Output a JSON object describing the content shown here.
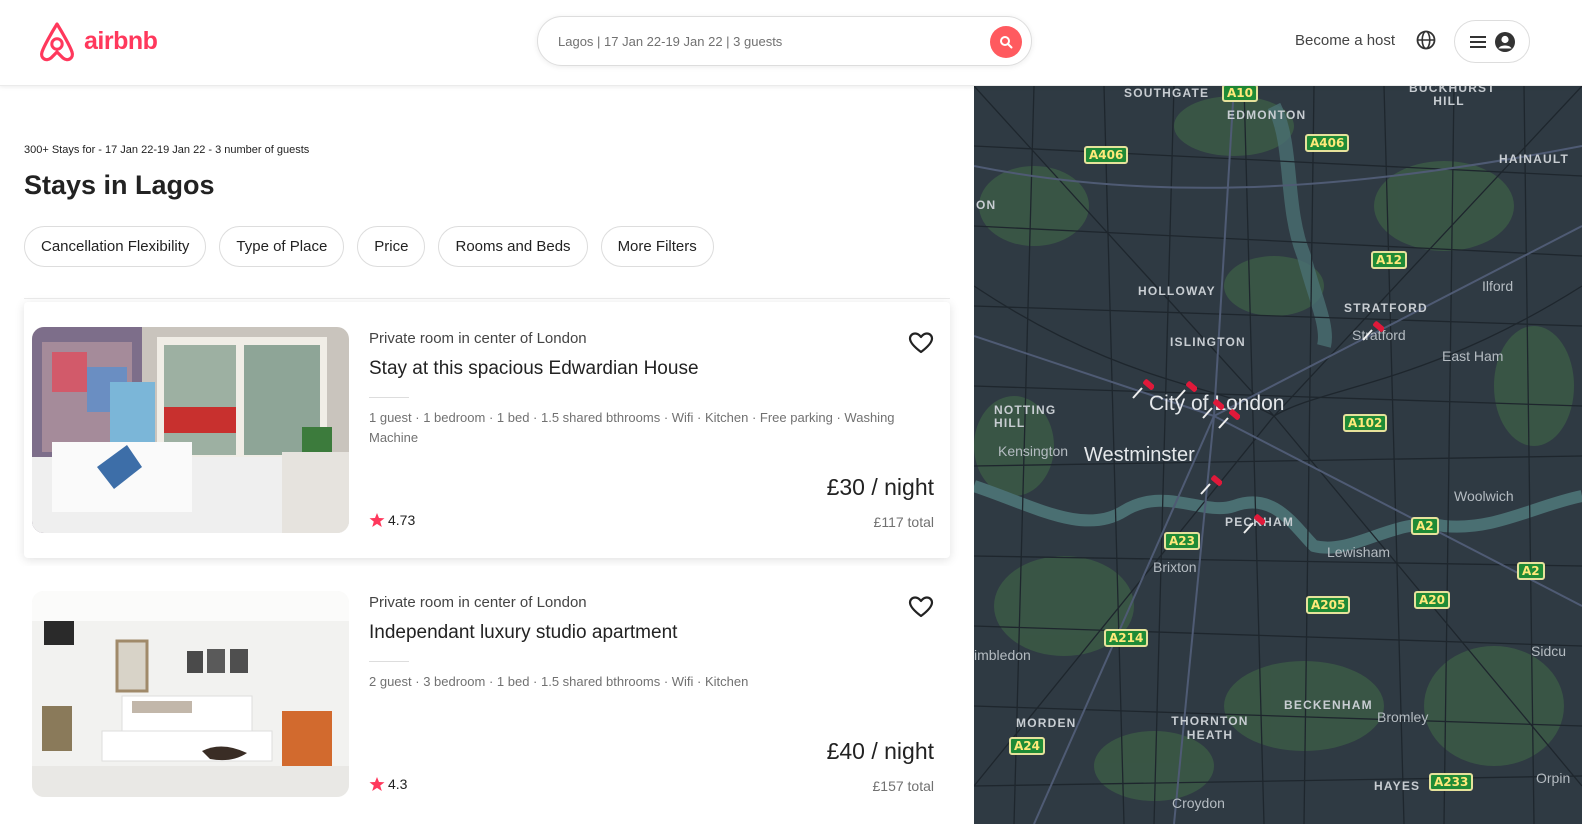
{
  "header": {
    "brand": "airbnb",
    "search_text": "Lagos | 17 Jan 22-19 Jan 22 | 3 guests",
    "become_host": "Become a host"
  },
  "results": {
    "summary": "300+ Stays for - 17 Jan 22-19 Jan 22 - 3 number of guests",
    "title": "Stays in Lagos",
    "filters": [
      "Cancellation Flexibility",
      "Type of Place",
      "Price",
      "Rooms and Beds",
      "More Filters"
    ]
  },
  "listings": [
    {
      "subtitle": "Private room in center of London",
      "title": "Stay at this spacious Edwardian House",
      "amenities": "1 guest · 1 bedroom · 1 bed · 1.5 shared bthrooms · Wifi · Kitchen · Free parking · Washing Machine",
      "price": "£30 / night",
      "rating": "4.73",
      "total": "£117 total"
    },
    {
      "subtitle": "Private room in center of London",
      "title": "Independant luxury studio apartment",
      "amenities": "2 guest · 3 bedroom · 1 bed · 1.5 shared bthrooms · Wifi · Kitchen",
      "price": "£40 / night",
      "rating": "4.3",
      "total": "£157 total"
    }
  ],
  "map": {
    "places": {
      "southgate": "SOUTHGATE",
      "edmonton": "EDMONTON",
      "buckhurst_hill": "BUCKHURST HILL",
      "hainault": "HAINAULT",
      "on": "ON",
      "holloway": "HOLLOWAY",
      "stratford_caps": "STRATFORD",
      "stratford": "Stratford",
      "ilford": "Ilford",
      "islington": "ISLINGTON",
      "east_ham": "East Ham",
      "notting_hill": "NOTTING HILL",
      "city_of_london": "City of London",
      "kensington": "Kensington",
      "westminster": "Westminster",
      "woolwich": "Woolwich",
      "peckham": "PECKHAM",
      "brixton": "Brixton",
      "lewisham": "Lewisham",
      "wimbledon": "imbledon",
      "sidcup": "Sidcu",
      "morden": "MORDEN",
      "thornton_heath": "THORNTON HEATH",
      "beckenham": "BECKENHAM",
      "bromley": "Bromley",
      "hayes": "HAYES",
      "orpington": "Orpin",
      "croydon": "Croydon"
    },
    "roads": {
      "a10": "A10",
      "a406_left": "A406",
      "a406_right": "A406",
      "a12": "A12",
      "a102": "A102",
      "a2_mid": "A2",
      "a2_right": "A2",
      "a23": "A23",
      "a205": "A205",
      "a20": "A20",
      "a214": "A214",
      "a24": "A24",
      "a233": "A233"
    }
  },
  "colors": {
    "brand": "#ff385c",
    "search_button": "#ff5a5f",
    "map_bg": "#2f3a43",
    "road_badge": "#1f8b36"
  }
}
